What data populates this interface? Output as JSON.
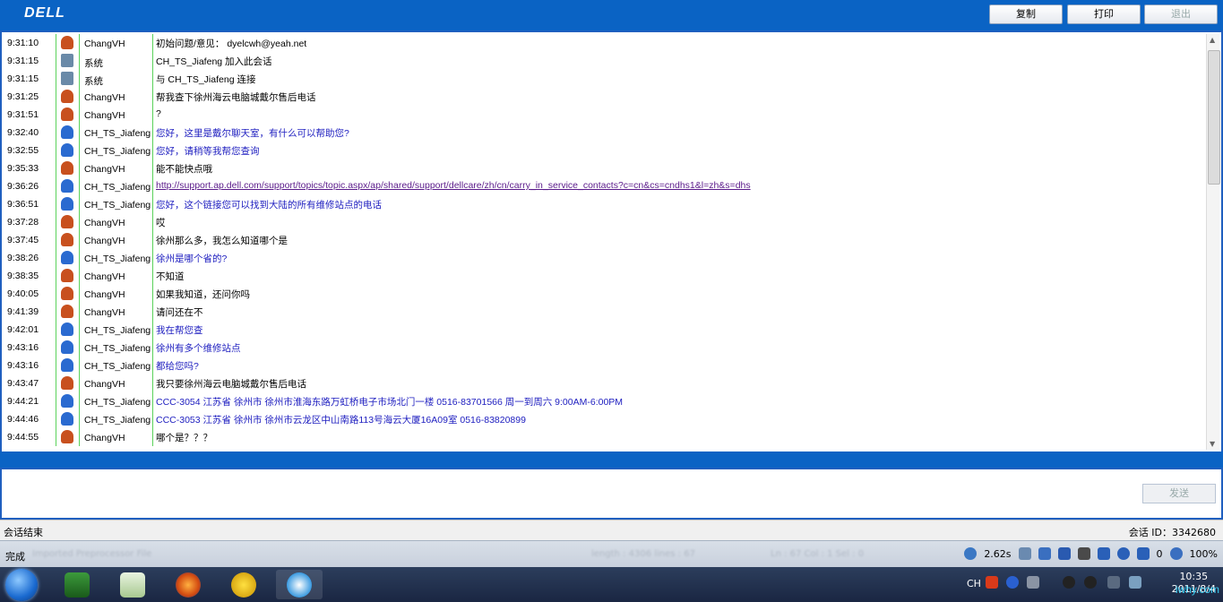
{
  "header": {
    "logo": "DELL",
    "buttons": {
      "copy": "复制",
      "print": "打印",
      "exit": "退出"
    }
  },
  "chat": {
    "rows": [
      {
        "time": "9:31:10",
        "user": "ChangVH",
        "role": "customer",
        "message": "初始问题/意见：  dyelcwh@yeah.net"
      },
      {
        "time": "9:31:15",
        "user": "系统",
        "role": "system",
        "message": "CH_TS_Jiafeng 加入此会话"
      },
      {
        "time": "9:31:15",
        "user": "系统",
        "role": "system",
        "message": "与  CH_TS_Jiafeng 连接"
      },
      {
        "time": "9:31:25",
        "user": "ChangVH",
        "role": "customer",
        "message": "帮我查下徐州海云电脑城戴尔售后电话"
      },
      {
        "time": "9:31:51",
        "user": "ChangVH",
        "role": "customer",
        "message": "?"
      },
      {
        "time": "9:32:40",
        "user": "CH_TS_Jiafeng",
        "role": "agent",
        "message": "您好，这里是戴尔聊天室，有什么可以帮助您?"
      },
      {
        "time": "9:32:55",
        "user": "CH_TS_Jiafeng",
        "role": "agent",
        "message": "您好，请稍等我帮您查询"
      },
      {
        "time": "9:35:33",
        "user": "ChangVH",
        "role": "customer",
        "message": "能不能快点哦"
      },
      {
        "time": "9:36:26",
        "user": "CH_TS_Jiafeng",
        "role": "link",
        "message": "http://support.ap.dell.com/support/topics/topic.aspx/ap/shared/support/dellcare/zh/cn/carry_in_service_contacts?c=cn&cs=cndhs1&l=zh&s=dhs"
      },
      {
        "time": "9:36:51",
        "user": "CH_TS_Jiafeng",
        "role": "agent",
        "message": "您好，这个链接您可以找到大陆的所有维修站点的电话"
      },
      {
        "time": "9:37:28",
        "user": "ChangVH",
        "role": "customer",
        "message": "哎"
      },
      {
        "time": "9:37:45",
        "user": "ChangVH",
        "role": "customer",
        "message": "徐州那么多，我怎么知道哪个是"
      },
      {
        "time": "9:38:26",
        "user": "CH_TS_Jiafeng",
        "role": "agent",
        "message": "徐州是哪个省的?"
      },
      {
        "time": "9:38:35",
        "user": "ChangVH",
        "role": "customer",
        "message": "不知道"
      },
      {
        "time": "9:40:05",
        "user": "ChangVH",
        "role": "customer",
        "message": "如果我知道，还问你吗"
      },
      {
        "time": "9:41:39",
        "user": "ChangVH",
        "role": "customer",
        "message": "请问还在不"
      },
      {
        "time": "9:42:01",
        "user": "CH_TS_Jiafeng",
        "role": "agent",
        "message": "我在帮您查"
      },
      {
        "time": "9:43:16",
        "user": "CH_TS_Jiafeng",
        "role": "agent",
        "message": "徐州有多个维修站点"
      },
      {
        "time": "9:43:16",
        "user": "CH_TS_Jiafeng",
        "role": "agent",
        "message": "都给您吗?"
      },
      {
        "time": "9:43:47",
        "user": "ChangVH",
        "role": "customer",
        "message": "我只要徐州海云电脑城戴尔售后电话"
      },
      {
        "time": "9:44:21",
        "user": "CH_TS_Jiafeng",
        "role": "agent",
        "message": "CCC-3054 江苏省  徐州市  徐州市淮海东路万虹桥电子市场北门一楼  0516-83701566 周一到周六  9:00AM-6:00PM"
      },
      {
        "time": "9:44:46",
        "user": "CH_TS_Jiafeng",
        "role": "agent",
        "message": "CCC-3053 江苏省  徐州市  徐州市云龙区中山南路113号海云大厦16A09室  0516-83820899"
      },
      {
        "time": "9:44:55",
        "user": "ChangVH",
        "role": "customer",
        "message": "哪个是？？？"
      }
    ]
  },
  "input": {
    "send_label": "发送"
  },
  "status": {
    "left": "会话结束",
    "right": "会话 ID：3342680"
  },
  "ie_status": {
    "done": "完成",
    "zone_blur": "Imported Preprocessor File",
    "length_blur": "length : 4306   lines : 67",
    "pos_blur": "Ln : 67    Col : 1    Sel : 0",
    "speed": "2.62s",
    "zero": "0",
    "zoom": "100%"
  },
  "taskbar": {
    "apps": [
      "windows-start",
      "vim",
      "notepad-plus-plus",
      "firefox",
      "ultraedit",
      "sogou"
    ],
    "lang": "CH",
    "time": "10:35",
    "date": "2011/8/4",
    "watermark": "iwhy.com"
  },
  "colors": {
    "brand": "#0a63c4",
    "agent_text": "#2020c0",
    "link_text": "#5a1a8a",
    "separator": "#5ad25a"
  }
}
